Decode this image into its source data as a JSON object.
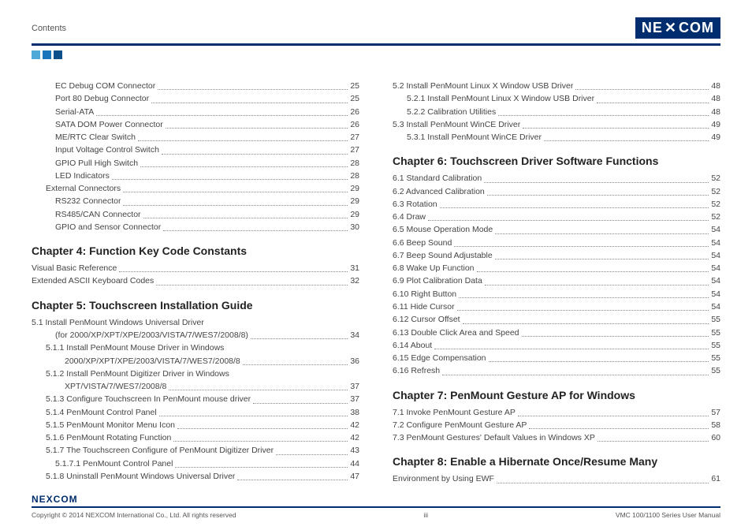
{
  "header": {
    "title": "Contents",
    "logo_text_a": "NE",
    "logo_text_b": "COM"
  },
  "footer": {
    "logo": "NEXCOM",
    "copyright": "Copyright © 2014 NEXCOM International Co., Ltd. All rights reserved",
    "pagenum": "iii",
    "manual": "VMC 100/1100 Series User Manual"
  },
  "col_left": [
    {
      "type": "line",
      "indent": 2,
      "label": "EC Debug COM Connector",
      "page": "25"
    },
    {
      "type": "line",
      "indent": 2,
      "label": "Port 80 Debug Connector",
      "page": "25"
    },
    {
      "type": "line",
      "indent": 2,
      "label": "Serial-ATA",
      "page": "26"
    },
    {
      "type": "line",
      "indent": 2,
      "label": "SATA DOM Power Connector",
      "page": "26"
    },
    {
      "type": "line",
      "indent": 2,
      "label": "ME/RTC Clear Switch",
      "page": "27"
    },
    {
      "type": "line",
      "indent": 2,
      "label": "Input Voltage Control Switch",
      "page": "27"
    },
    {
      "type": "line",
      "indent": 2,
      "label": "GPIO Pull High Switch",
      "page": "28"
    },
    {
      "type": "line",
      "indent": 2,
      "label": "LED Indicators",
      "page": "28"
    },
    {
      "type": "line",
      "indent": 1,
      "label": "External Connectors",
      "page": "29"
    },
    {
      "type": "line",
      "indent": 2,
      "label": "RS232 Connector",
      "page": "29"
    },
    {
      "type": "line",
      "indent": 2,
      "label": "RS485/CAN Connector",
      "page": "29"
    },
    {
      "type": "line",
      "indent": 2,
      "label": "GPIO and Sensor Connector",
      "page": "30"
    },
    {
      "type": "chapter",
      "label": "Chapter 4: Function Key Code Constants"
    },
    {
      "type": "line",
      "indent": 0,
      "label": "Visual Basic Reference",
      "page": "31"
    },
    {
      "type": "line",
      "indent": 0,
      "label": "Extended ASCII Keyboard Codes",
      "page": "32"
    },
    {
      "type": "chapter",
      "label": "Chapter 5: Touchscreen Installation Guide"
    },
    {
      "type": "line",
      "indent": 0,
      "label": "5.1  Install PenMount Windows Universal Driver",
      "nopage": true
    },
    {
      "type": "line",
      "indent": 2,
      "label": "(for 2000/XP/XPT/XPE/2003/VISTA/7/WES7/2008/8)",
      "page": "34"
    },
    {
      "type": "line",
      "indent": 1,
      "label": "5.1.1  Install PenMount Mouse Driver in Windows",
      "nopage": true
    },
    {
      "type": "line",
      "indent": 3,
      "label": "2000/XP/XPT/XPE/2003/VISTA/7/WES7/2008/8",
      "page": "36"
    },
    {
      "type": "line",
      "indent": 1,
      "label": "5.1.2  Install PenMount Digitizer Driver in Windows",
      "nopage": true
    },
    {
      "type": "line",
      "indent": 3,
      "label": "XPT/VISTA/7/WES7/2008/8",
      "page": "37"
    },
    {
      "type": "line",
      "indent": 1,
      "label": "5.1.3  Configure Touchscreen In PenMount mouse driver",
      "page": "37"
    },
    {
      "type": "line",
      "indent": 1,
      "label": "5.1.4  PenMount Control Panel",
      "page": "38"
    },
    {
      "type": "line",
      "indent": 1,
      "label": "5.1.5  PenMount Monitor Menu Icon",
      "page": "42"
    },
    {
      "type": "line",
      "indent": 1,
      "label": "5.1.6  PenMount Rotating Function",
      "page": "42"
    },
    {
      "type": "line",
      "indent": 1,
      "label": "5.1.7  The Touchscreen Configure of PenMount Digitizer Driver",
      "page": "43"
    },
    {
      "type": "line",
      "indent": 2,
      "label": "5.1.7.1  PenMount Control Panel",
      "page": "44"
    },
    {
      "type": "line",
      "indent": 1,
      "label": "5.1.8  Uninstall PenMount Windows Universal Driver",
      "page": "47"
    }
  ],
  "col_right": [
    {
      "type": "line",
      "indent": 0,
      "label": "5.2  Install PenMount Linux X Window USB Driver",
      "page": "48"
    },
    {
      "type": "line",
      "indent": 1,
      "label": "5.2.1  Install PenMount Linux X Window USB Driver",
      "page": "48"
    },
    {
      "type": "line",
      "indent": 1,
      "label": "5.2.2  Calibration Utilities",
      "page": "48"
    },
    {
      "type": "line",
      "indent": 0,
      "label": "5.3  Install PenMount WinCE Driver",
      "page": "49"
    },
    {
      "type": "line",
      "indent": 1,
      "label": "5.3.1  Install PenMount WinCE Driver",
      "page": "49"
    },
    {
      "type": "chapter",
      "label": "Chapter 6: Touchscreen Driver Software Functions"
    },
    {
      "type": "line",
      "indent": 0,
      "label": "6.1  Standard Calibration",
      "page": "52"
    },
    {
      "type": "line",
      "indent": 0,
      "label": "6.2  Advanced Calibration",
      "page": "52"
    },
    {
      "type": "line",
      "indent": 0,
      "label": "6.3  Rotation",
      "page": "52"
    },
    {
      "type": "line",
      "indent": 0,
      "label": "6.4  Draw",
      "page": "52"
    },
    {
      "type": "line",
      "indent": 0,
      "label": "6.5  Mouse Operation Mode",
      "page": "54"
    },
    {
      "type": "line",
      "indent": 0,
      "label": "6.6  Beep Sound",
      "page": "54"
    },
    {
      "type": "line",
      "indent": 0,
      "label": "6.7  Beep Sound Adjustable",
      "page": "54"
    },
    {
      "type": "line",
      "indent": 0,
      "label": "6.8  Wake Up Function",
      "page": "54"
    },
    {
      "type": "line",
      "indent": 0,
      "label": "6.9  Plot Calibration Data",
      "page": "54"
    },
    {
      "type": "line",
      "indent": 0,
      "label": "6.10  Right Button",
      "page": "54"
    },
    {
      "type": "line",
      "indent": 0,
      "label": "6.11  Hide Cursor",
      "page": "54"
    },
    {
      "type": "line",
      "indent": 0,
      "label": "6.12  Cursor Offset",
      "page": "55"
    },
    {
      "type": "line",
      "indent": 0,
      "label": "6.13  Double Click Area and Speed",
      "page": "55"
    },
    {
      "type": "line",
      "indent": 0,
      "label": "6.14  About",
      "page": "55"
    },
    {
      "type": "line",
      "indent": 0,
      "label": "6.15  Edge Compensation",
      "page": "55"
    },
    {
      "type": "line",
      "indent": 0,
      "label": "6.16  Refresh",
      "page": "55"
    },
    {
      "type": "chapter",
      "label": "Chapter 7: PenMount Gesture AP for Windows"
    },
    {
      "type": "line",
      "indent": 0,
      "label": "7.1  Invoke PenMount Gesture AP",
      "page": "57"
    },
    {
      "type": "line",
      "indent": 0,
      "label": "7.2  Configure PenMount Gesture AP",
      "page": "58"
    },
    {
      "type": "line",
      "indent": 0,
      "label": "7.3  PenMount Gestures' Default Values in Windows XP",
      "page": "60"
    },
    {
      "type": "chapter",
      "label": "Chapter 8: Enable a Hibernate Once/Resume Many"
    },
    {
      "type": "line",
      "indent": 0,
      "label": "Environment by Using EWF",
      "page": "61"
    }
  ]
}
